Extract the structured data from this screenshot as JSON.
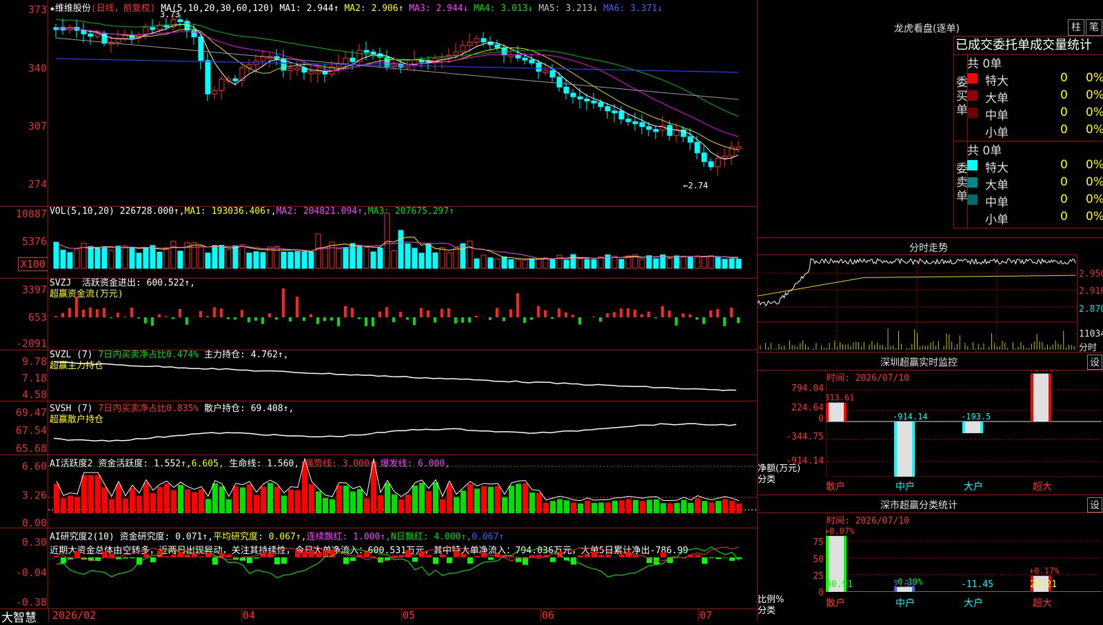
{
  "main": {
    "title": "★维维股份",
    "period": "(日线，前复权)",
    "ma_label": "MA(5,10,20,30,60,120)",
    "ma": [
      "MA1: 2.944↑",
      "MA2: 2.906↑",
      "MA3: 2.944↓",
      "MA4: 3.013↓",
      "MA5: 3.213↓",
      "MA6: 3.371↓"
    ],
    "high_label": "3.73",
    "low_label": "←2.74",
    "y_ticks": [
      "373",
      "340",
      "307",
      "274"
    ]
  },
  "vol": {
    "label": "VOL(5,10,20)",
    "value": "226728.000↑,",
    "ma1": "MA1: 193036.406↑,",
    "ma2": "MA2: 204821.094↑,",
    "ma3": "MA3: 207675.297↑",
    "y_ticks": [
      "10887",
      "5376",
      "X100"
    ]
  },
  "svzj": {
    "label": "SVZJ",
    "text1": "活跃资金进出: 600.522↑,",
    "text2": "超赢资金流(万元)",
    "y_ticks": [
      "3397",
      "653",
      "-2091"
    ]
  },
  "svzl": {
    "label": "SVZL (7)",
    "text1": "7日内买卖净占比0.474%",
    "text2": "主力持仓: 4.762↑,",
    "text3": "超赢主力持仓",
    "y_ticks": [
      "9.78",
      "7.18",
      "4.58"
    ]
  },
  "svsh": {
    "label": "SVSH (7)",
    "text1": "7日内买卖净占比0.835%",
    "text2": "散户持仓: 69.408↑,",
    "text3": "超赢散户持仓",
    "y_ticks": [
      "69.47",
      "67.54",
      "65.68"
    ]
  },
  "ai2": {
    "label": "AI活跃度2",
    "t1": "资金活跃度: 1.552↑,",
    "t2": "6.605,",
    "t3": "生命线: 1.560,",
    "t4": "强势线: 3.000,",
    "t5": "爆发线: 6.000,",
    "y_ticks": [
      "6.60",
      "3.26",
      "0.00"
    ]
  },
  "ai3": {
    "label": "AI研究度2(10)",
    "t1": "资金研究度: 0.071↑,",
    "t2": "平均研究度: 0.067↑,",
    "t3": "连续飘红: 1.000↑,",
    "t4": "N日飘红: 4.000↑,",
    "t5": "0.067↑",
    "comment": "近期大资金总体由空转多，近两日出现异动，关注其持续性，今日大单净流入：600.531万元，其中特大单净流入：794.036万元，大单5日累计净出-786.99",
    "y_ticks": [
      "0.30",
      "-0.04",
      "-0.38"
    ]
  },
  "xaxis": {
    "brand": "大智慧",
    "labels": [
      "2026/02",
      "04",
      "05",
      "06",
      "07"
    ]
  },
  "longhu": {
    "title": "龙虎看盘(逐单)",
    "btn1": "柱",
    "btn2": "笔",
    "subtitle": "已成交委托单成交量统计",
    "buy_side": "委买单",
    "sell_side": "委卖单",
    "buy_total": "共 0单",
    "sell_total": "共 0单",
    "buy_rows": [
      {
        "name": "特大",
        "val": "0",
        "pct": "0%"
      },
      {
        "name": "大单",
        "val": "0",
        "pct": "0%"
      },
      {
        "name": "中单",
        "val": "0",
        "pct": "0%"
      },
      {
        "name": "小单",
        "val": "0",
        "pct": "0%"
      }
    ],
    "sell_rows": [
      {
        "name": "特大",
        "val": "0",
        "pct": "0%"
      },
      {
        "name": "大单",
        "val": "0",
        "pct": "0%"
      },
      {
        "name": "中单",
        "val": "0",
        "pct": "0%"
      },
      {
        "name": "小单",
        "val": "0",
        "pct": "0%"
      }
    ]
  },
  "fenshi": {
    "title": "分时走势",
    "y_ticks": [
      "2.950",
      "2.910",
      "2.870"
    ],
    "vol_label": "11034",
    "x_label": "分时"
  },
  "sz_monitor": {
    "title": "深圳超赢实时监控",
    "btn": "设",
    "time": "时间: 2026/07/10",
    "y_ticks": [
      "794.04",
      "224.64",
      "0",
      "-344.75",
      "-914.14"
    ],
    "ylabel1": "净额(万元)",
    "ylabel2": "分类",
    "values": [
      "313.61",
      "-914.14",
      "-193.5",
      "794.04"
    ],
    "cats": [
      "散户",
      "中户",
      "大户",
      "超大"
    ]
  },
  "sz_class": {
    "title": "深市超赢分类统计",
    "btn": "设",
    "time": "时间: 2026/07/10",
    "y_ticks": [
      "75",
      "50",
      "25",
      "0"
    ],
    "ylabel1": "比例%",
    "ylabel2": "分类",
    "pct": [
      "+0.07%",
      "-0.19%",
      "",
      "+0.17%"
    ],
    "values": [
      "80.91",
      "7.33",
      "-11.45",
      "23.21"
    ],
    "cats": [
      "散户",
      "中户",
      "大户",
      "超大"
    ]
  }
}
